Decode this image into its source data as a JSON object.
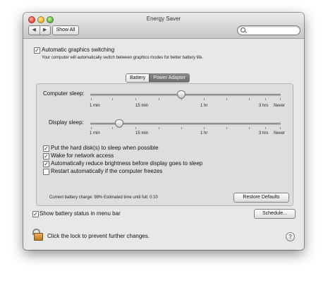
{
  "window": {
    "title": "Energy Saver",
    "nav": {
      "back": "◀",
      "forward": "▶"
    },
    "show_all_label": "Show All",
    "search": {
      "value": "",
      "placeholder": ""
    }
  },
  "graphics": {
    "auto_switch_label": "Automatic graphics switching",
    "auto_switch_checked": true,
    "description": "Your computer will automatically switch between graphics modes for better battery life."
  },
  "tabs": [
    {
      "label": "Battery",
      "active": false
    },
    {
      "label": "Power Adapter",
      "active": true
    }
  ],
  "sliders": {
    "computer_sleep": {
      "label": "Computer sleep:",
      "value": "1 hr",
      "ticks": [
        "1 min",
        "15 min",
        "1 hr",
        "3 hrs",
        "Never"
      ]
    },
    "display_sleep": {
      "label": "Display sleep:",
      "value": "~10 min",
      "ticks": [
        "1 min",
        "15 min",
        "1 hr",
        "3 hrs",
        "Never"
      ]
    }
  },
  "options": [
    {
      "label": "Put the hard disk(s) to sleep when possible",
      "checked": true
    },
    {
      "label": "Wake for network access",
      "checked": true
    },
    {
      "label": "Automatically reduce brightness before display goes to sleep",
      "checked": true
    },
    {
      "label": "Restart automatically if the computer freezes",
      "checked": false
    }
  ],
  "status": {
    "text": "Current battery charge: 98%  Estimated time until full: 0:10"
  },
  "restore_defaults_label": "Restore Defaults",
  "battery_menu": {
    "label": "Show battery status in menu bar",
    "checked": true
  },
  "schedule_label": "Schedule...",
  "lock_text": "Click the lock to prevent further changes.",
  "help_label": "?",
  "check_glyph": "✓",
  "colors": {
    "window_bg": "#e8e8e8",
    "active_tab": "#7a7a7a"
  }
}
